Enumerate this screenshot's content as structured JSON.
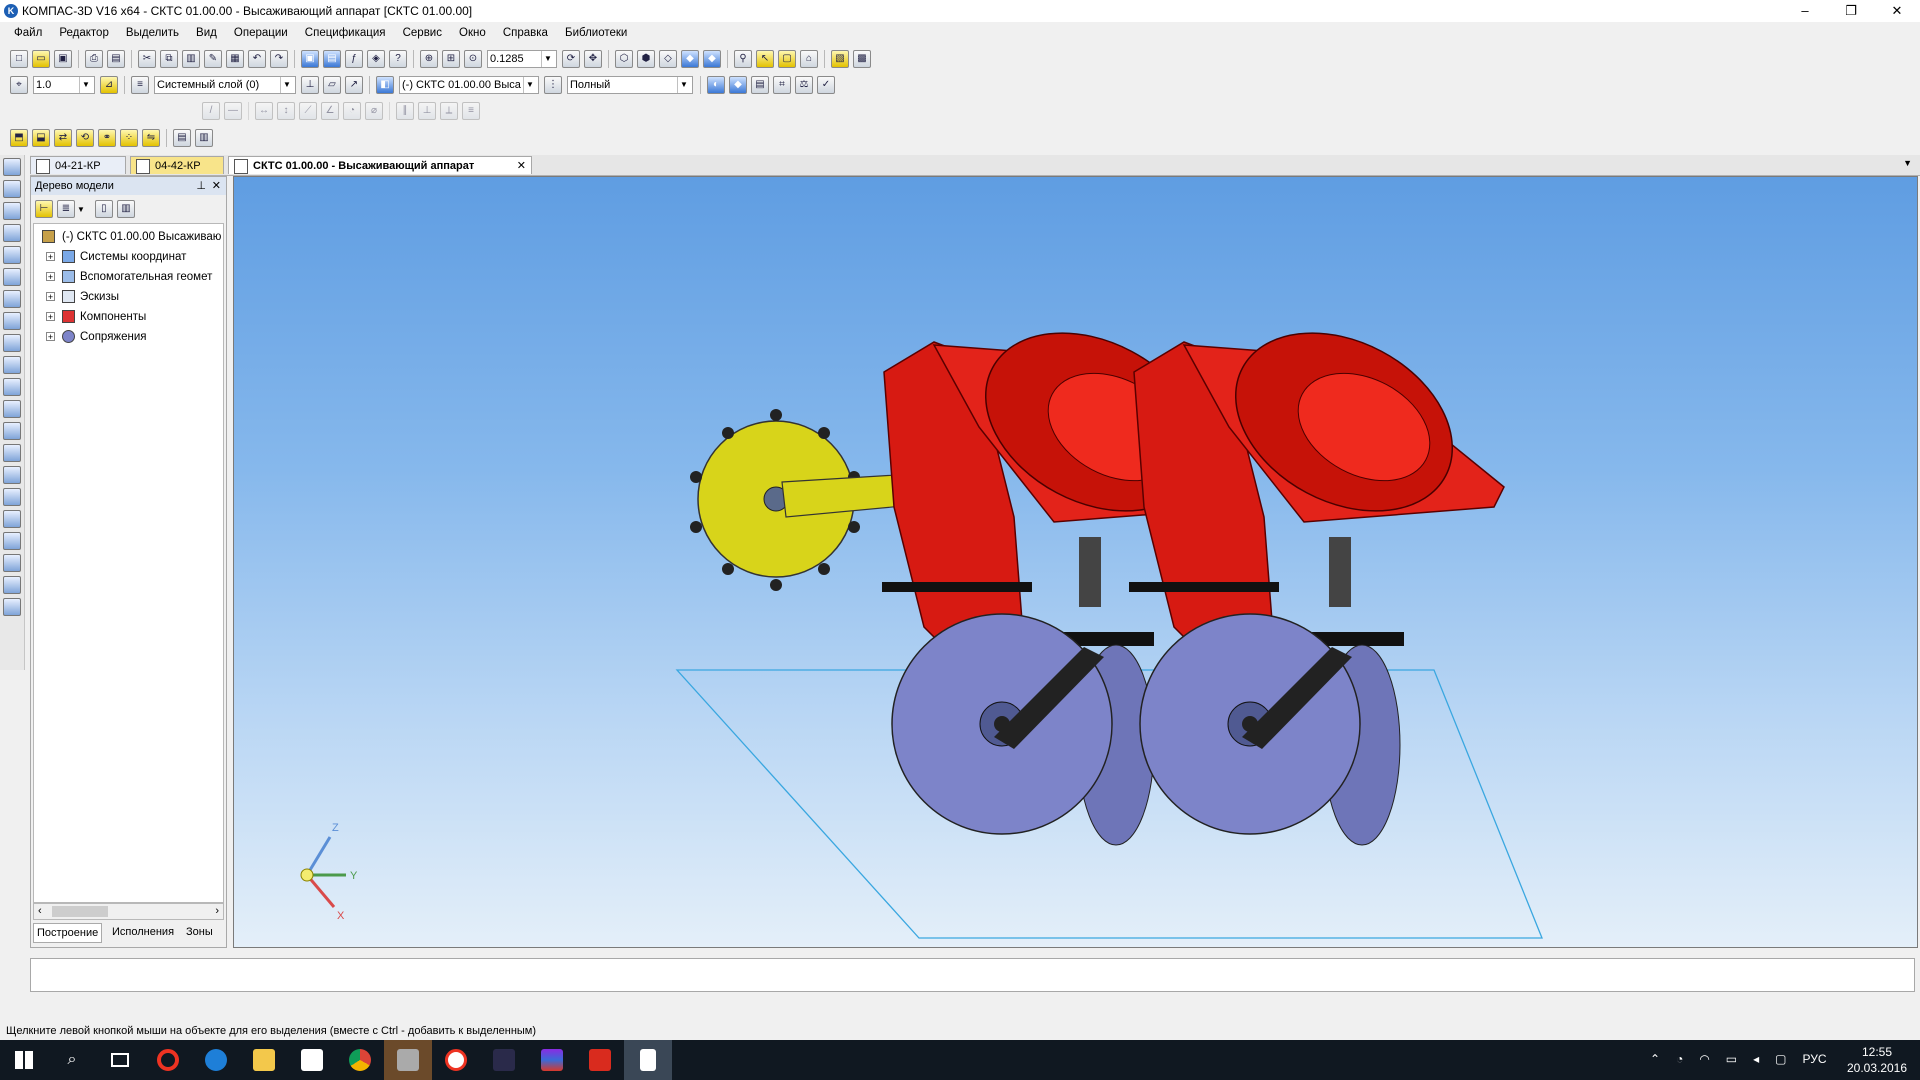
{
  "window": {
    "title": "КОМПАС-3D V16  x64 - СКТС 01.00.00 - Высаживающий аппарат [СКТС 01.00.00]",
    "minimize_glyph": "–",
    "maximize_glyph": "❐",
    "close_glyph": "✕"
  },
  "menu": [
    "Файл",
    "Редактор",
    "Выделить",
    "Вид",
    "Операции",
    "Спецификация",
    "Сервис",
    "Окно",
    "Справка",
    "Библиотеки"
  ],
  "toolbar": {
    "zoom_value": "0.1285",
    "step_value": "1.0",
    "layer_value": "Системный слой (0)",
    "object_value": "(-) СКТС 01.00.00 Выса",
    "detail_value": "Полный"
  },
  "tabs": [
    {
      "label": "04-21-КР",
      "state": "normal"
    },
    {
      "label": "04-42-КР",
      "state": "highlighted"
    },
    {
      "label": "СКТС 01.00.00 - Высаживающий аппарат",
      "state": "active",
      "close": "✕"
    }
  ],
  "tree_panel": {
    "title": "Дерево модели",
    "pin_glyph": "⊥",
    "close_glyph": "✕",
    "root": "(-) СКТС 01.00.00 Высаживаю",
    "items": [
      "Системы координат",
      "Вспомогательная геомет",
      "Эскизы",
      "Компоненты",
      "Сопряжения"
    ],
    "expander_glyph": "+",
    "bottom_tabs": [
      "Построение",
      "Исполнения",
      "Зоны"
    ],
    "scroll_left": "‹",
    "scroll_right": "›"
  },
  "axes": {
    "z": "Z",
    "y": "Y",
    "x": "X"
  },
  "status": {
    "hint": "Щелкните левой кнопкой мыши на объекте для его выделения (вместе с Ctrl - добавить к выделенным)"
  },
  "taskbar": {
    "lang": "РУС",
    "time": "12:55",
    "date": "20.03.2016"
  },
  "colors": {
    "frame_red": "#d71a12",
    "wheel_yellow": "#d8d41a",
    "disc_blue": "#7d84c9",
    "viewport_top": "#5f9de2"
  }
}
